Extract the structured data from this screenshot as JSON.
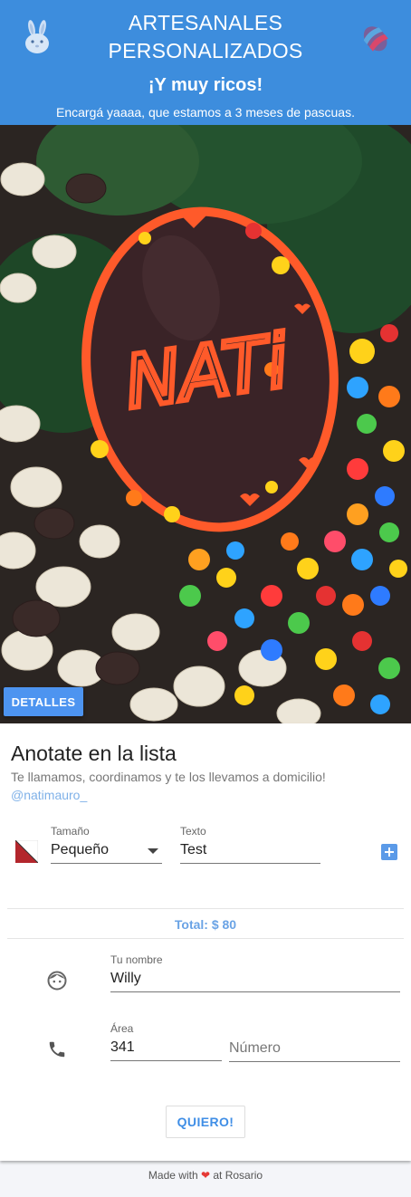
{
  "header": {
    "title": "ARTESANALES PERSONALIZADOS",
    "subtitle": "¡Y muy ricos!",
    "tagline": "Encargá yaaaa, que estamos a 3 meses de pascuas."
  },
  "hero": {
    "egg_text": "NATi",
    "details_label": "DETALLES"
  },
  "form": {
    "title": "Anotate en la lista",
    "description": "Te llamamos, coordinamos y te los llevamos a domicilio!",
    "instagram": "@natimauro_",
    "size_label": "Tamaño",
    "size_value": "Pequeño",
    "text_label": "Texto",
    "text_value": "Test",
    "total": "Total: $ 80",
    "name_label": "Tu nombre",
    "name_value": "Willy",
    "area_label": "Área",
    "area_value": "341",
    "number_placeholder": "Número",
    "submit_label": "QUIERO!"
  },
  "footer": {
    "before": "Made with",
    "heart": "❤",
    "after": "at Rosario"
  },
  "colors": {
    "header": "#3d8ddd",
    "accent": "#4d94f0",
    "egg": "#3a2327",
    "icing": "#ff5a2a"
  }
}
